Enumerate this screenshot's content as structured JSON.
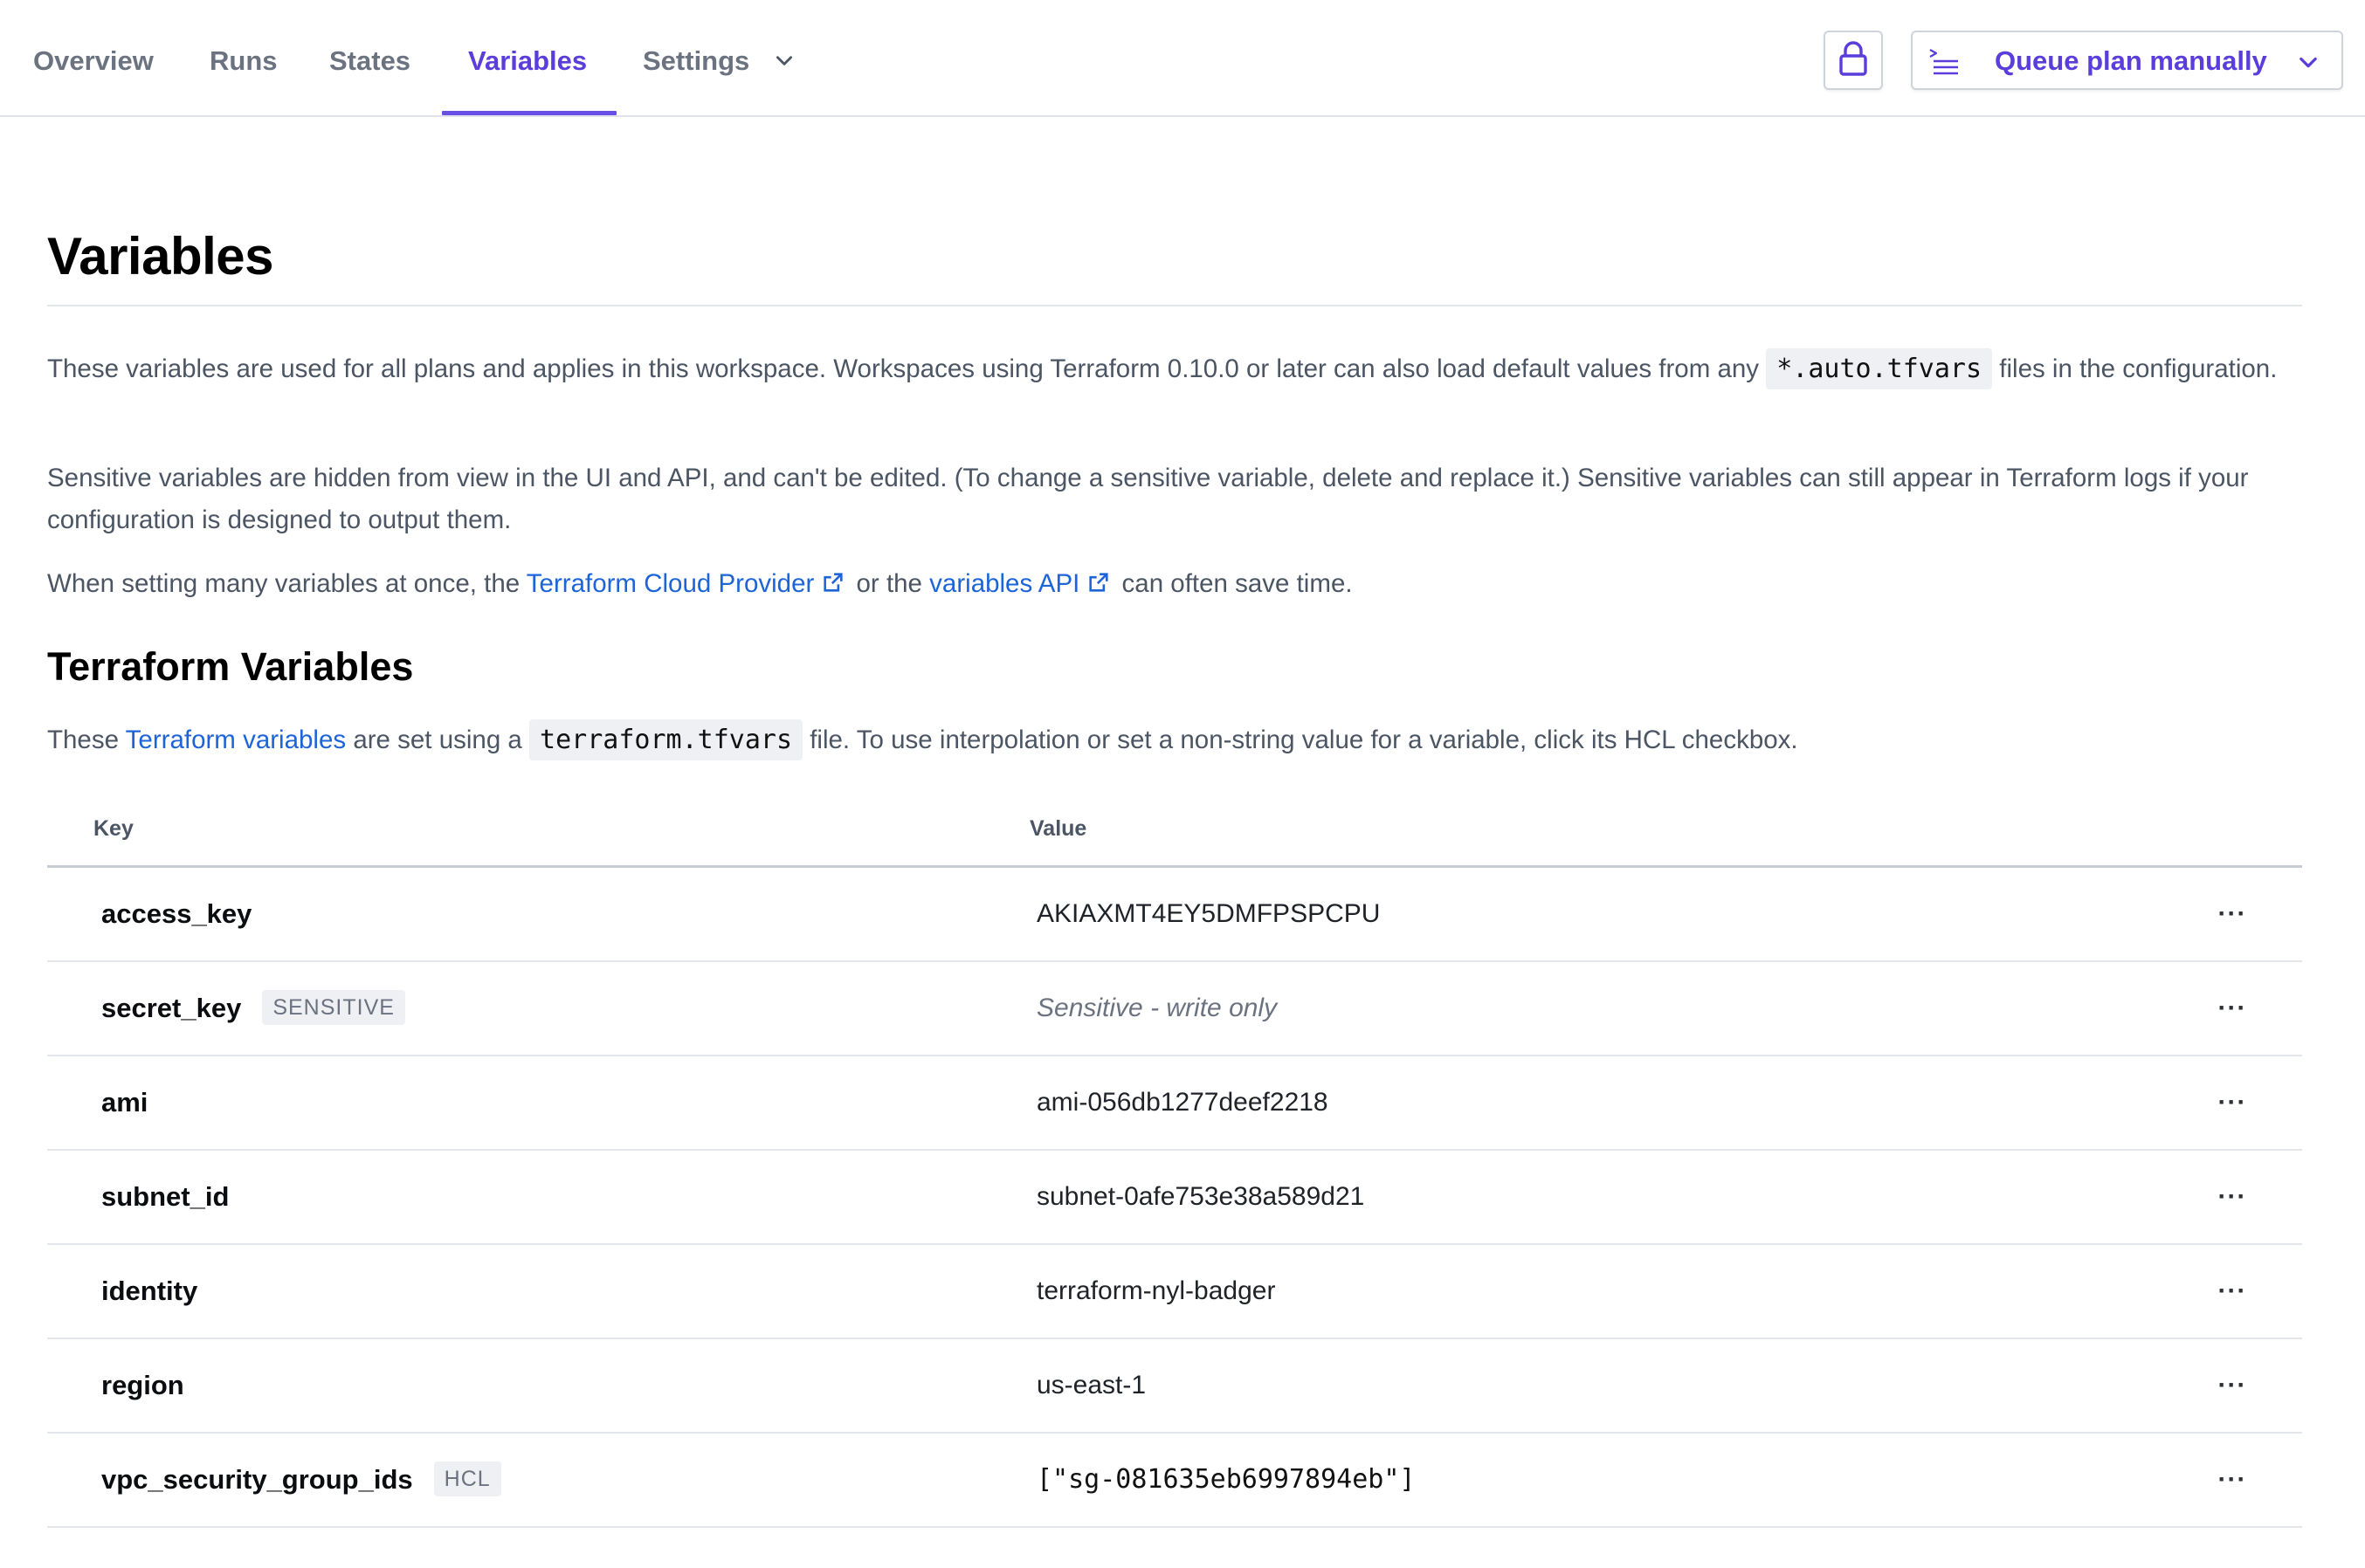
{
  "nav": {
    "tabs": [
      {
        "label": "Overview"
      },
      {
        "label": "Runs"
      },
      {
        "label": "States"
      },
      {
        "label": "Variables"
      },
      {
        "label": "Settings"
      }
    ],
    "active_tab": "Variables",
    "queue_button_label": "Queue plan manually",
    "accent_color": "#5a3ddb",
    "icons": [
      "lock-icon",
      "terminal-list-icon",
      "chevron-down-icon"
    ]
  },
  "page": {
    "title": "Variables",
    "intro": {
      "p1_before": "These variables are used for all plans and applies in this workspace. Workspaces using Terraform 0.10.0 or later can also load default values from any ",
      "p1_code": "*.auto.tfvars",
      "p1_after": " files in the configuration.",
      "p2": "Sensitive variables are hidden from view in the UI and API, and can't be edited. (To change a sensitive variable, delete and replace it.) Sensitive variables can still appear in Terraform logs if your configuration is designed to output them.",
      "p3_before": "When setting many variables at once, the ",
      "p3_link1": "Terraform Cloud Provider",
      "p3_middle": " or the ",
      "p3_link2": "variables API",
      "p3_after": " can often save time."
    }
  },
  "terraform_variables": {
    "title": "Terraform Variables",
    "desc_before": "These ",
    "desc_link": "Terraform variables",
    "desc_middle": " are set using a ",
    "desc_code": "terraform.tfvars",
    "desc_after": " file. To use interpolation or set a non-string value for a variable, click its HCL checkbox.",
    "columns": {
      "key": "Key",
      "value": "Value"
    },
    "rows": [
      {
        "key": "access_key",
        "badge": "",
        "value": "AKIAXMT4EY5DMFPSPCPU",
        "style": "plain"
      },
      {
        "key": "secret_key",
        "badge": "SENSITIVE",
        "value": "Sensitive - write only",
        "style": "sensitive"
      },
      {
        "key": "ami",
        "badge": "",
        "value": "ami-056db1277deef2218",
        "style": "plain"
      },
      {
        "key": "subnet_id",
        "badge": "",
        "value": "subnet-0afe753e38a589d21",
        "style": "plain"
      },
      {
        "key": "identity",
        "badge": "",
        "value": "terraform-nyl-badger",
        "style": "plain"
      },
      {
        "key": "region",
        "badge": "",
        "value": "us-east-1",
        "style": "plain"
      },
      {
        "key": "vpc_security_group_ids",
        "badge": "HCL",
        "value": "[\"sg-081635eb6997894eb\"]",
        "style": "mono"
      }
    ],
    "row_menu_label": "···"
  }
}
